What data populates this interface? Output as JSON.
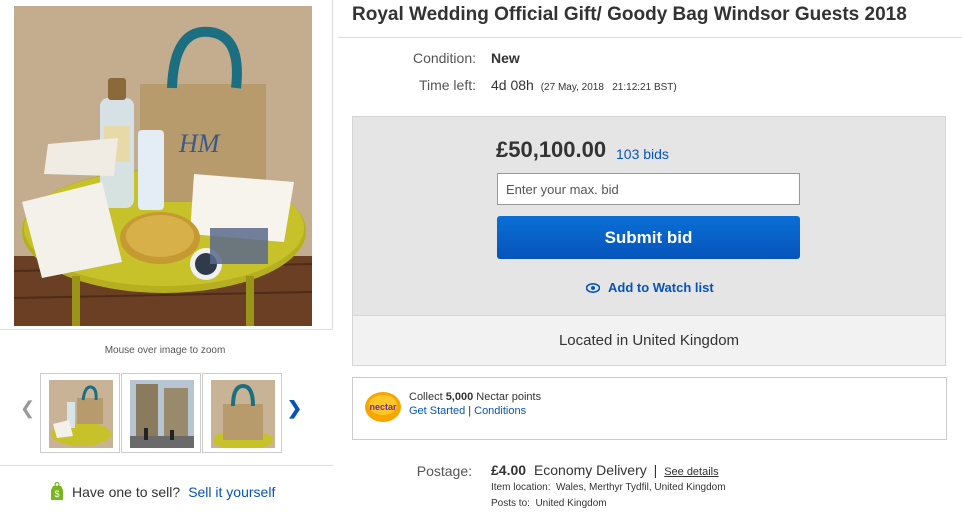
{
  "listing": {
    "title": "Royal Wedding Official Gift/ Goody Bag Windsor Guests 2018",
    "condition_label": "Condition:",
    "condition_value": "New",
    "time_left_label": "Time left:",
    "time_left_value": "4d 08h",
    "time_left_end": "(27 May, 2018   21:12:21 BST)"
  },
  "bidding": {
    "price": "£50,100.00",
    "bid_count": "103 bids",
    "bid_placeholder": "Enter your max. bid",
    "submit_label": "Submit bid",
    "watch_label": "Add to Watch list",
    "location": "Located in United Kingdom"
  },
  "nectar": {
    "logo_text": "nectar",
    "collect_prefix": "Collect ",
    "points": "5,000",
    "collect_suffix": " Nectar points",
    "get_started": "Get Started",
    "separator": "|",
    "conditions": "Conditions"
  },
  "shipping": {
    "postage_label": "Postage:",
    "cost": "£4.00",
    "service": "Economy Delivery",
    "separator": "|",
    "see_details": "See details",
    "item_location": "Item location:  Wales, Merthyr Tydfil, United Kingdom",
    "posts_to": "Posts to:  United Kingdom"
  },
  "gallery": {
    "zoom_hint": "Mouse over image to zoom",
    "thumbnails": [
      "goody bag on table",
      "Windsor street",
      "jute bag"
    ]
  },
  "sell": {
    "prompt": "Have one to sell?",
    "link": "Sell it yourself"
  },
  "colors": {
    "link": "#0654ba",
    "button": "#0654ba",
    "bid_box": "#e5e5e5",
    "nectar": "#f7a600"
  }
}
